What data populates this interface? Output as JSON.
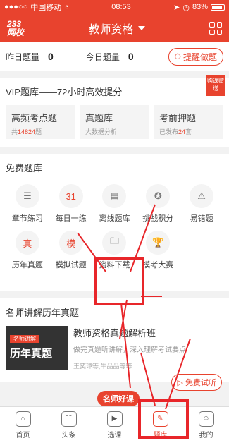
{
  "status": {
    "carrier": "中国移动",
    "time": "08:53",
    "battery": "83%"
  },
  "header": {
    "logo_line1": "233",
    "logo_line2": "网校",
    "title": "教师资格"
  },
  "counts": {
    "yesterday_label": "昨日题量",
    "yesterday_value": "0",
    "today_label": "今日题量",
    "today_value": "0",
    "remind_label": "提醒做题"
  },
  "vip": {
    "title": "VIP题库——72小时高效提分",
    "ribbon": "购课赠送",
    "cards": [
      {
        "title": "高频考点题",
        "sub_pre": "共",
        "sub_num": "14824",
        "sub_post": "题"
      },
      {
        "title": "真题库",
        "sub_pre": "大数据分析",
        "sub_num": "",
        "sub_post": ""
      },
      {
        "title": "考前押题",
        "sub_pre": "已发布",
        "sub_num": "24",
        "sub_post": "套"
      }
    ]
  },
  "free": {
    "title": "免费题库",
    "items": [
      {
        "label": "章节练习",
        "icon": "list-icon"
      },
      {
        "label": "每日一练",
        "icon": "calendar-icon",
        "glyph": "31"
      },
      {
        "label": "离线题库",
        "icon": "offline-icon"
      },
      {
        "label": "挑战积分",
        "icon": "medal-icon"
      },
      {
        "label": "易错题",
        "icon": "alarm-icon"
      },
      {
        "label": "历年真题",
        "icon": "paper-icon",
        "glyph": "真"
      },
      {
        "label": "模拟试题",
        "icon": "mock-icon",
        "glyph": "模"
      },
      {
        "label": "资料下载",
        "icon": "folder-icon"
      },
      {
        "label": "模考大赛",
        "icon": "trophy-icon"
      }
    ]
  },
  "lecture": {
    "title": "名师讲解历年真题",
    "thumb_tag": "名师讲解",
    "thumb_text": "历年真题",
    "name": "教师资格真题解析班",
    "desc": "做完真题听讲解，深入理解考试要点",
    "authors": "王奕璋等,牛品品等等",
    "trial": "免费试听",
    "badge": "名师好课"
  },
  "tabs": [
    {
      "label": "首页",
      "icon": "home-icon"
    },
    {
      "label": "头条",
      "icon": "news-icon"
    },
    {
      "label": "选课",
      "icon": "course-icon"
    },
    {
      "label": "题库",
      "icon": "pencil-icon"
    },
    {
      "label": "我的",
      "icon": "profile-icon"
    }
  ],
  "colors": {
    "accent": "#e8432e",
    "highlight": "#e8262a"
  }
}
